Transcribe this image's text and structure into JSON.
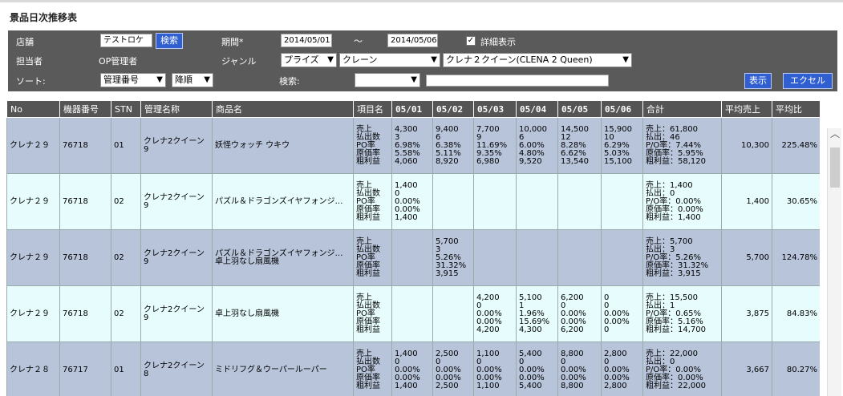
{
  "title": "景品日次推移表",
  "filters": {
    "store_label": "店舗",
    "store_value": "テストロケ",
    "search_store_btn": "検索",
    "period_label": "期間*",
    "period_from": "2014/05/01",
    "period_sep": "～",
    "period_to": "2014/05/06",
    "detail_check": "✓",
    "detail_label": "詳細表示",
    "person_label": "担当者",
    "person_value": "OP管理者",
    "genre_label": "ジャンル",
    "genre1": "プライズ",
    "genre2": "クレーン",
    "genre3": "クレナ２クイーン(CLENA 2 Queen)",
    "sort_label": "ソート:",
    "sort_field": "管理番号",
    "sort_order": "降順",
    "search_label": "検索:",
    "search_select": "",
    "search_text": "",
    "show_btn": "表示",
    "excel_btn": "エクセル"
  },
  "table": {
    "headers": [
      "No",
      "機器番号",
      "STN",
      "管理名称",
      "商品名",
      "項目名",
      "05/01",
      "05/02",
      "05/03",
      "05/04",
      "05/05",
      "05/06",
      "合計",
      "平均売上",
      "平均比"
    ],
    "rows": [
      {
        "no": "クレナ２９",
        "machine": "76718",
        "stn": "01",
        "mgmt": "クレナ2クイーン\n9",
        "product": "妖怪ウォッチ ウキウ",
        "metrics": "売上\n払出数\nPO率\n原価率\n粗利益",
        "d1": "4,300\n3\n6.98%\n5.58%\n4,060",
        "d2": "9,400\n6\n6.38%\n5.11%\n8,920",
        "d3": "7,700\n9\n11.69%\n9.35%\n6,980",
        "d4": "10,000\n6\n6.00%\n4.80%\n9,520",
        "d5": "14,500\n12\n8.28%\n6.62%\n13,540",
        "d6": "15,900\n10\n6.29%\n5.03%\n15,100",
        "sum": "売上：61,800\n払出：46\nP/O率：7.44%\n原価率：5.95%\n粗利益：58,120",
        "avg": "10,300",
        "ratio": "225.48%"
      },
      {
        "no": "クレナ２９",
        "machine": "76718",
        "stn": "02",
        "mgmt": "クレナ2クイーン\n9",
        "product": "パズル＆ドラゴンズイヤフォンジ…",
        "metrics": "売上\n払出数\nPO率\n原価率\n粗利益",
        "d1": "1,400\n0\n0.00%\n0.00%\n1,400",
        "d2": "",
        "d3": "",
        "d4": "",
        "d5": "",
        "d6": "",
        "sum": "売上：1,400\n払出：0\nP/O率：0.00%\n原価率：0.00%\n粗利益：1,400",
        "avg": "1,400",
        "ratio": "30.65%"
      },
      {
        "no": "クレナ２９",
        "machine": "76718",
        "stn": "02",
        "mgmt": "クレナ2クイーン\n9",
        "product": "パズル＆ドラゴンズイヤフォンジ…\n卓上羽なし扇風機",
        "metrics": "売上\n払出数\nPO率\n原価率\n粗利益",
        "d1": "",
        "d2": "5,700\n3\n5.26%\n31.32%\n3,915",
        "d3": "",
        "d4": "",
        "d5": "",
        "d6": "",
        "sum": "売上：5,700\n払出：3\nP/O率：5.26%\n原価率：31.32%\n粗利益：3,915",
        "avg": "5,700",
        "ratio": "124.78%"
      },
      {
        "no": "クレナ２９",
        "machine": "76718",
        "stn": "02",
        "mgmt": "クレナ2クイーン\n9",
        "product": "卓上羽なし扇風機",
        "metrics": "売上\n払出数\nPO率\n原価率\n粗利益",
        "d1": "",
        "d2": "",
        "d3": "4,200\n0\n0.00%\n0.00%\n4,200",
        "d4": "5,100\n1\n1.96%\n15.69%\n4,300",
        "d5": "6,200\n0\n0.00%\n0.00%\n6,200",
        "d6": "0\n0\n0.00%\n0.00%\n0",
        "sum": "売上：15,500\n払出：1\nP/O率：0.65%\n原価率：5.16%\n粗利益：14,700",
        "avg": "3,875",
        "ratio": "84.83%"
      },
      {
        "no": "クレナ２８",
        "machine": "76717",
        "stn": "01",
        "mgmt": "クレナ2クイーン\n8",
        "product": "ミドリフグ＆ウーパールーパー",
        "metrics": "売上\n払出数\nPO率\n原価率\n粗利益",
        "d1": "1,400\n0\n0.00%\n0.00%\n1,400",
        "d2": "2,500\n0\n0.00%\n0.00%\n2,500",
        "d3": "1,100\n0\n0.00%\n0.00%\n1,100",
        "d4": "5,400\n0\n0.00%\n0.00%\n5,400",
        "d5": "8,800\n0\n0.00%\n0.00%\n8,800",
        "d6": "2,800\n0\n0.00%\n0.00%\n2,800",
        "sum": "売上：22,000\n払出：0\nP/O率：0.00%\n原価率：0.00%\n粗利益：22,000",
        "avg": "3,667",
        "ratio": "80.27%"
      }
    ]
  }
}
